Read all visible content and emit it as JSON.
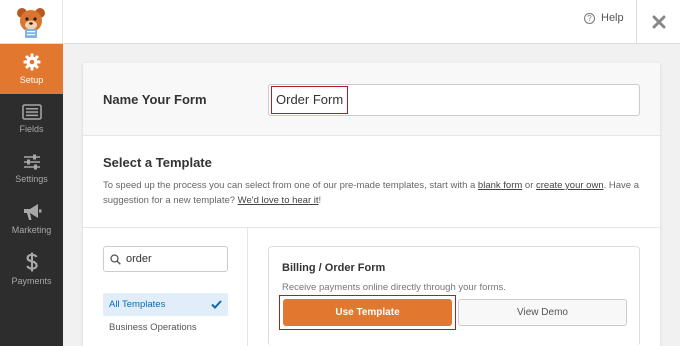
{
  "header": {
    "help_label": "Help"
  },
  "sidebar": {
    "items": [
      {
        "label": "Setup",
        "icon": "gear-icon"
      },
      {
        "label": "Fields",
        "icon": "fields-icon"
      },
      {
        "label": "Settings",
        "icon": "sliders-icon"
      },
      {
        "label": "Marketing",
        "icon": "megaphone-icon"
      },
      {
        "label": "Payments",
        "icon": "dollar-icon"
      }
    ]
  },
  "form": {
    "name_label": "Name Your Form",
    "name_value": "Order Form",
    "select_title": "Select a Template",
    "desc_part1": "To speed up the process you can select from one of our pre-made templates, start with a ",
    "desc_link1": "blank form",
    "desc_part2": " or ",
    "desc_link2": "create your own",
    "desc_part3": ". Have a suggestion for a new template? ",
    "desc_link3": "We'd love to hear it",
    "desc_part4": "!"
  },
  "search": {
    "value": "order"
  },
  "categories": [
    {
      "label": "All Templates"
    },
    {
      "label": "Business Operations"
    }
  ],
  "template": {
    "title": "Billing / Order Form",
    "description": "Receive payments online directly through your forms.",
    "use_label": "Use Template",
    "demo_label": "View Demo"
  },
  "colors": {
    "accent": "#e27730",
    "sidebar": "#2d2d2d",
    "highlight": "#b31b27",
    "category_active": "#0a6bb5"
  }
}
